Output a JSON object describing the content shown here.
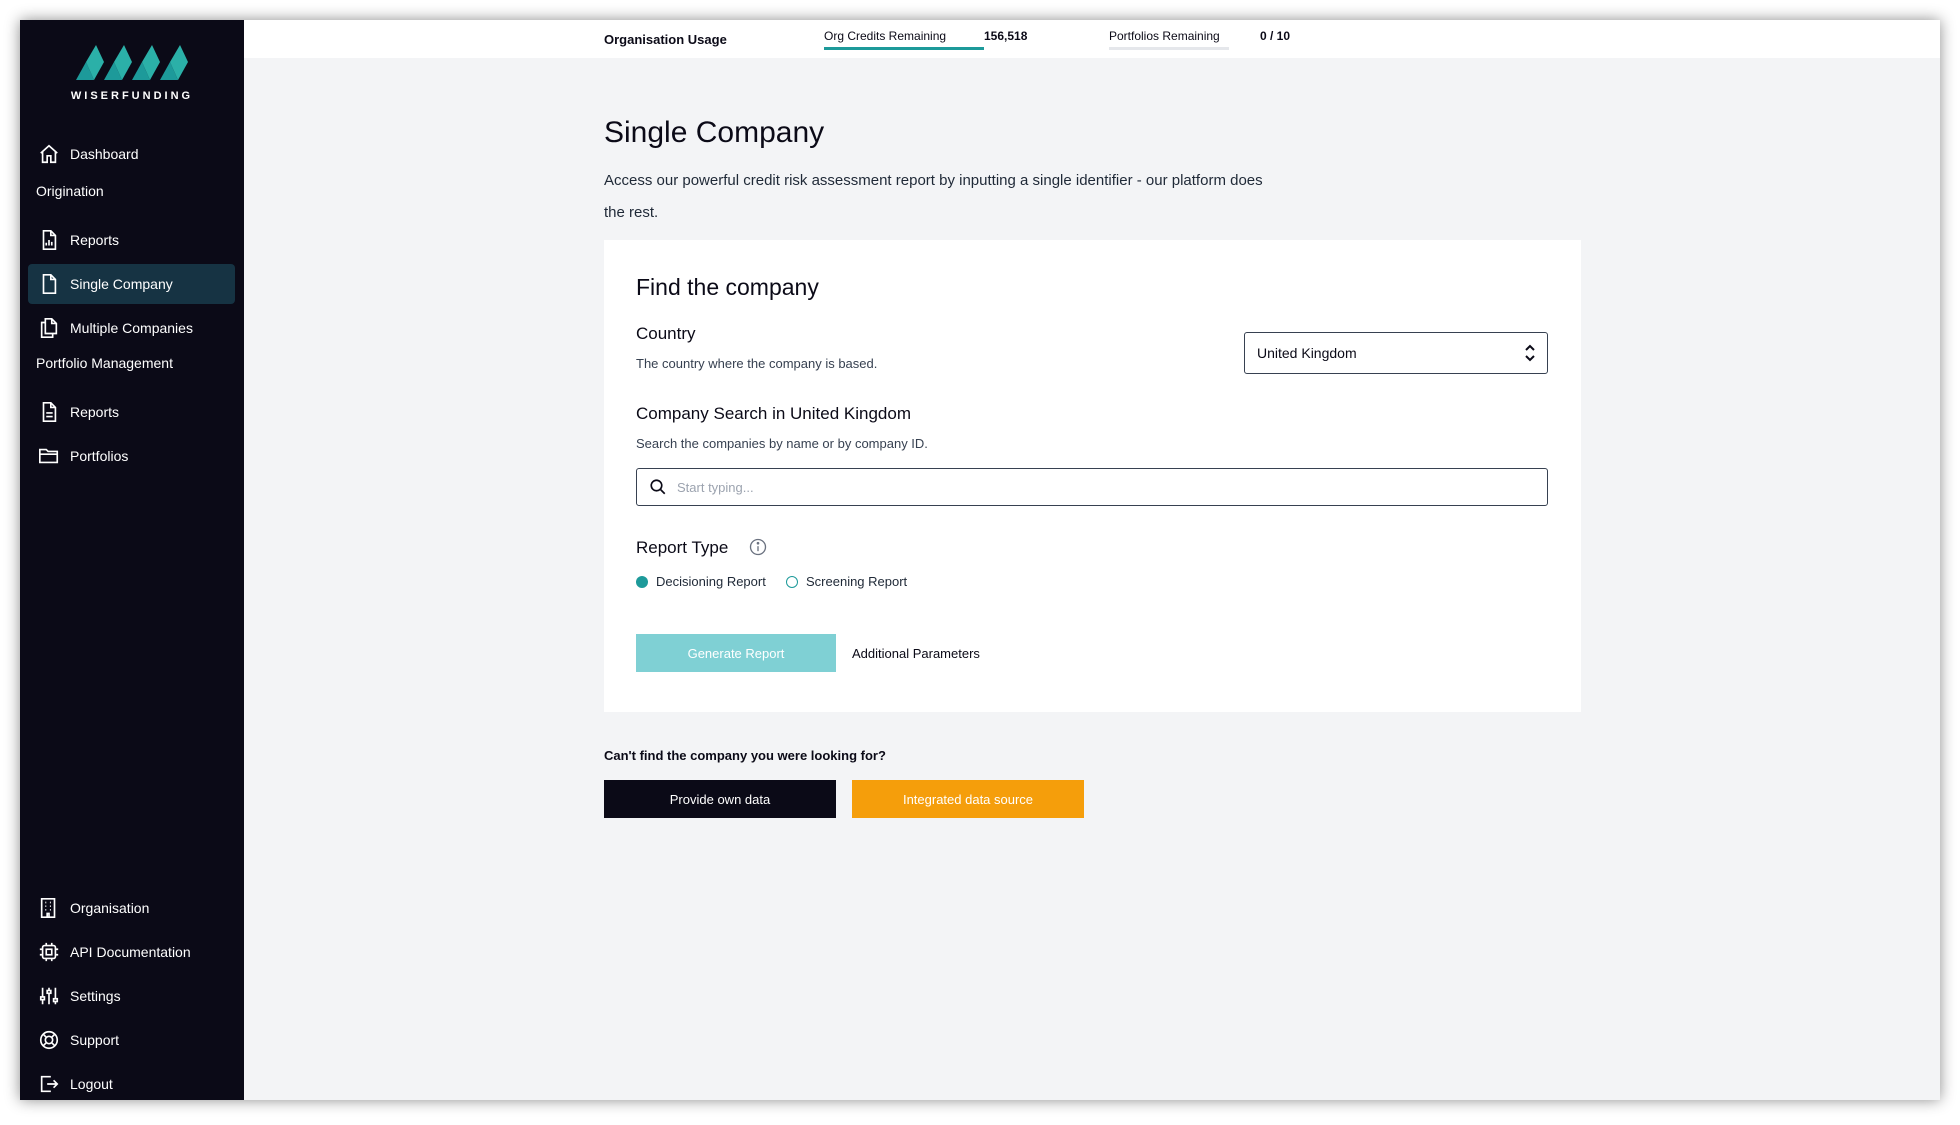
{
  "brand": {
    "name": "WISERFUNDING",
    "accent": "#1d9a9a",
    "sidebar_bg": "#0b0a17"
  },
  "sidebar": {
    "dashboard": {
      "label": "Dashboard",
      "icon": "home-icon"
    },
    "origination_heading": "Origination",
    "origination_items": [
      {
        "label": "Reports",
        "icon": "report-chart-icon"
      },
      {
        "label": "Single Company",
        "icon": "document-icon",
        "active": true
      },
      {
        "label": "Multiple Companies",
        "icon": "documents-icon"
      }
    ],
    "portfolio_heading": "Portfolio Management",
    "portfolio_items": [
      {
        "label": "Reports",
        "icon": "document-lines-icon"
      },
      {
        "label": "Portfolios",
        "icon": "folder-icon"
      }
    ],
    "bottom_items": [
      {
        "label": "Organisation",
        "icon": "building-icon"
      },
      {
        "label": "API Documentation",
        "icon": "chip-icon"
      },
      {
        "label": "Settings",
        "icon": "sliders-icon"
      },
      {
        "label": "Support",
        "icon": "lifebuoy-icon"
      },
      {
        "label": "Logout",
        "icon": "logout-icon"
      }
    ]
  },
  "topbar": {
    "title": "Organisation Usage",
    "credits_label": "Org Credits Remaining",
    "credits_value": "156,518",
    "credits_fill": 1.0,
    "portfolios_label": "Portfolios Remaining",
    "portfolios_value": "0 / 10",
    "portfolios_fill": 0.0
  },
  "main": {
    "title": "Single Company",
    "description": "Access our powerful credit risk assessment report by inputting a single identifier - our platform does the rest.",
    "card": {
      "title": "Find the company",
      "country_label": "Country",
      "country_hint": "The country where the company is based.",
      "country_selected": "United Kingdom",
      "search_label": "Company Search in United Kingdom",
      "search_hint": "Search the companies by name or by company ID.",
      "search_placeholder": "Start typing...",
      "search_value": "",
      "report_type_label": "Report Type",
      "report_options": [
        {
          "label": "Decisioning Report",
          "selected": true
        },
        {
          "label": "Screening Report",
          "selected": false
        }
      ],
      "generate_label": "Generate Report",
      "additional_label": "Additional Parameters"
    },
    "cant_find": "Can't find the company you were looking for?",
    "own_data_label": "Provide own data",
    "integrated_label": "Integrated data source"
  }
}
